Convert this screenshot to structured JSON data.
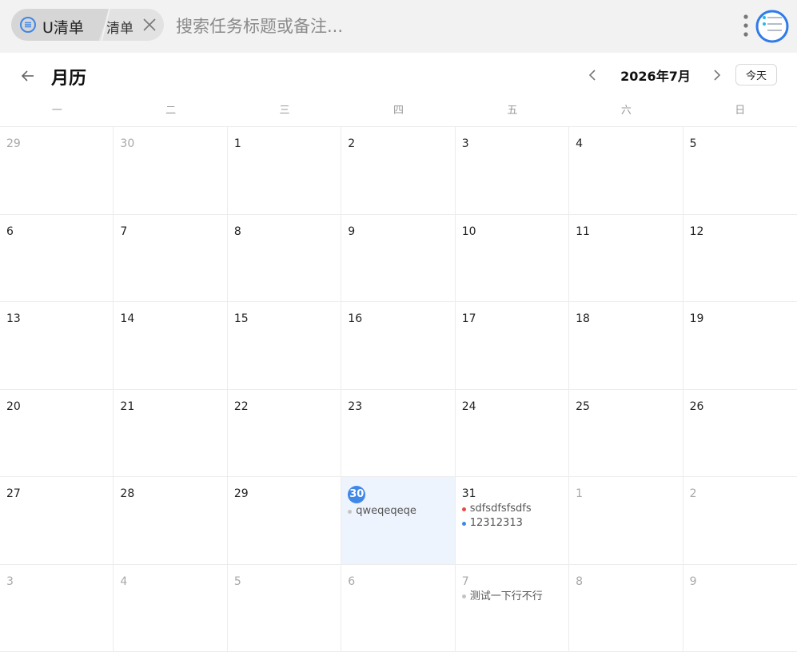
{
  "topbar": {
    "tab_main_label": "U清单",
    "tab_second_label": "清单",
    "search_placeholder": "搜索任务标题或备注..."
  },
  "header": {
    "title": "月历",
    "month_label": "2026年7月",
    "today_label": "今天"
  },
  "weekdays": [
    "一",
    "二",
    "三",
    "四",
    "五",
    "六",
    "日"
  ],
  "colors": {
    "accent": "#3f87e8",
    "today_bg": "#edf4fd",
    "task_red": "#e8484b",
    "task_blue": "#3f87e8",
    "task_gray": "#c4c4c4"
  },
  "weeks": [
    [
      {
        "day": "29",
        "other": true
      },
      {
        "day": "30",
        "other": true
      },
      {
        "day": "1"
      },
      {
        "day": "2"
      },
      {
        "day": "3"
      },
      {
        "day": "4"
      },
      {
        "day": "5"
      }
    ],
    [
      {
        "day": "6"
      },
      {
        "day": "7"
      },
      {
        "day": "8"
      },
      {
        "day": "9"
      },
      {
        "day": "10"
      },
      {
        "day": "11"
      },
      {
        "day": "12"
      }
    ],
    [
      {
        "day": "13"
      },
      {
        "day": "14"
      },
      {
        "day": "15"
      },
      {
        "day": "16"
      },
      {
        "day": "17"
      },
      {
        "day": "18"
      },
      {
        "day": "19"
      }
    ],
    [
      {
        "day": "20"
      },
      {
        "day": "21"
      },
      {
        "day": "22"
      },
      {
        "day": "23"
      },
      {
        "day": "24"
      },
      {
        "day": "25"
      },
      {
        "day": "26"
      }
    ],
    [
      {
        "day": "27"
      },
      {
        "day": "28"
      },
      {
        "day": "29"
      },
      {
        "day": "30",
        "today": true,
        "tasks": [
          {
            "title": "qweqeqeqe",
            "color": "#c4c4c4"
          }
        ]
      },
      {
        "day": "31",
        "tasks": [
          {
            "title": "sdfsdfsfsdfs",
            "color": "#e8484b"
          },
          {
            "title": "12312313",
            "color": "#3f87e8"
          }
        ]
      },
      {
        "day": "1",
        "other": true
      },
      {
        "day": "2",
        "other": true
      }
    ],
    [
      {
        "day": "3",
        "other": true
      },
      {
        "day": "4",
        "other": true
      },
      {
        "day": "5",
        "other": true
      },
      {
        "day": "6",
        "other": true
      },
      {
        "day": "7",
        "other": true,
        "tasks": [
          {
            "title": "测试一下行不行",
            "color": "#c4c4c4"
          }
        ]
      },
      {
        "day": "8",
        "other": true
      },
      {
        "day": "9",
        "other": true
      }
    ]
  ]
}
